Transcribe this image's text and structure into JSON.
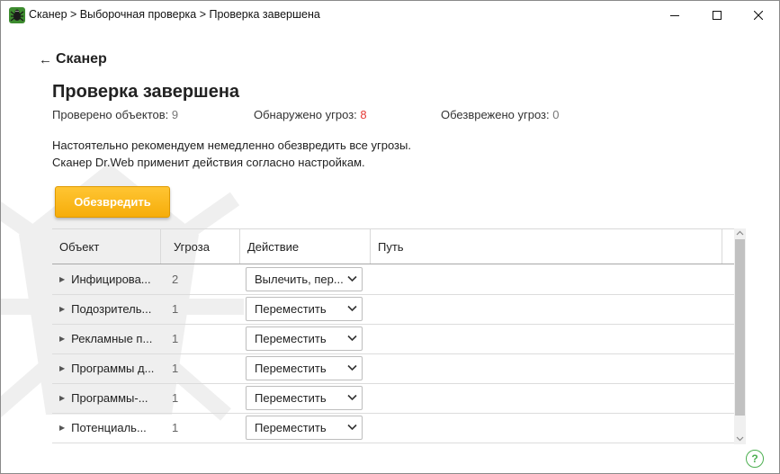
{
  "window": {
    "title": "Сканер > Выборочная проверка > Проверка завершена"
  },
  "nav": {
    "back_label": "Сканер"
  },
  "main": {
    "title": "Проверка завершена",
    "stats": [
      {
        "label": "Проверено объектов:",
        "value": "9"
      },
      {
        "label": "Обнаружено угроз:",
        "value": "8"
      },
      {
        "label": "Обезврежено угроз:",
        "value": "0"
      }
    ],
    "recommend_line1": "Настоятельно рекомендуем немедленно обезвредить все угрозы.",
    "recommend_line2": "Сканер Dr.Web применит действия согласно настройкам.",
    "neutralize_label": "Обезвредить"
  },
  "table": {
    "headers": [
      "Объект",
      "Угроза",
      "Действие",
      "Путь"
    ],
    "rows": [
      {
        "object": "Инфицирова...",
        "threats": "2",
        "action": "Вылечить, пер..."
      },
      {
        "object": "Подозритель...",
        "threats": "1",
        "action": "Переместить"
      },
      {
        "object": "Рекламные п...",
        "threats": "1",
        "action": "Переместить"
      },
      {
        "object": "Программы д...",
        "threats": "1",
        "action": "Переместить"
      },
      {
        "object": "Программы-...",
        "threats": "1",
        "action": "Переместить"
      },
      {
        "object": "Потенциаль...",
        "threats": "1",
        "action": "Переместить"
      }
    ]
  },
  "help": {
    "label": "?"
  },
  "colors": {
    "accent": "#f6ad0a",
    "threat_count": "#e53935",
    "help_green": "#4caf50"
  }
}
